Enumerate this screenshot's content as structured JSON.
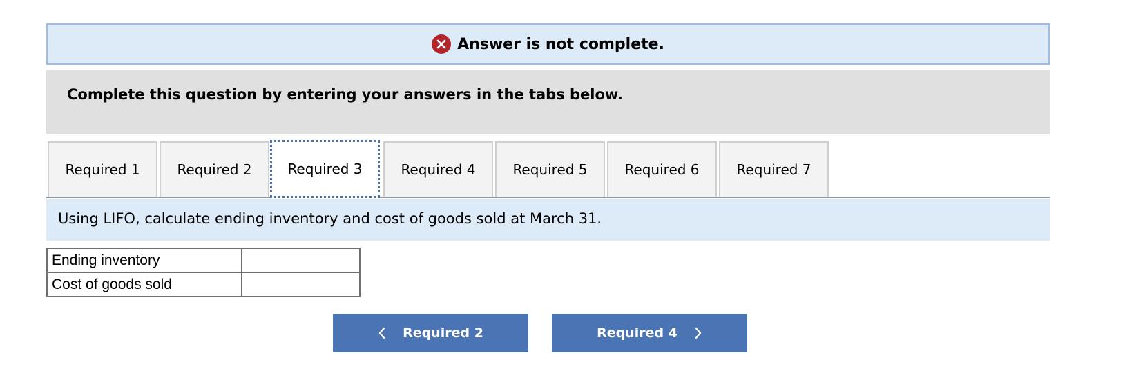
{
  "status": {
    "message": "Answer is not complete.",
    "icon": "x-circle-icon",
    "icon_color": "#b2262b"
  },
  "instruction": "Complete this question by entering your answers in the tabs below.",
  "tabs": [
    {
      "label": "Required 1"
    },
    {
      "label": "Required 2"
    },
    {
      "label": "Required 3"
    },
    {
      "label": "Required 4"
    },
    {
      "label": "Required 5"
    },
    {
      "label": "Required 6"
    },
    {
      "label": "Required 7"
    }
  ],
  "active_tab": "Required 3",
  "question": "Using LIFO, calculate ending inventory and cost of goods sold at March 31.",
  "table": {
    "rows": [
      {
        "label": "Ending inventory",
        "value": ""
      },
      {
        "label": "Cost of goods sold",
        "value": ""
      }
    ]
  },
  "navigation": {
    "prev_label": "Required 2",
    "next_label": "Required 4",
    "button_color": "#4a74b3"
  },
  "colors": {
    "banner_bg": "#ddebf8",
    "panel_bg": "#e0e0e0"
  }
}
